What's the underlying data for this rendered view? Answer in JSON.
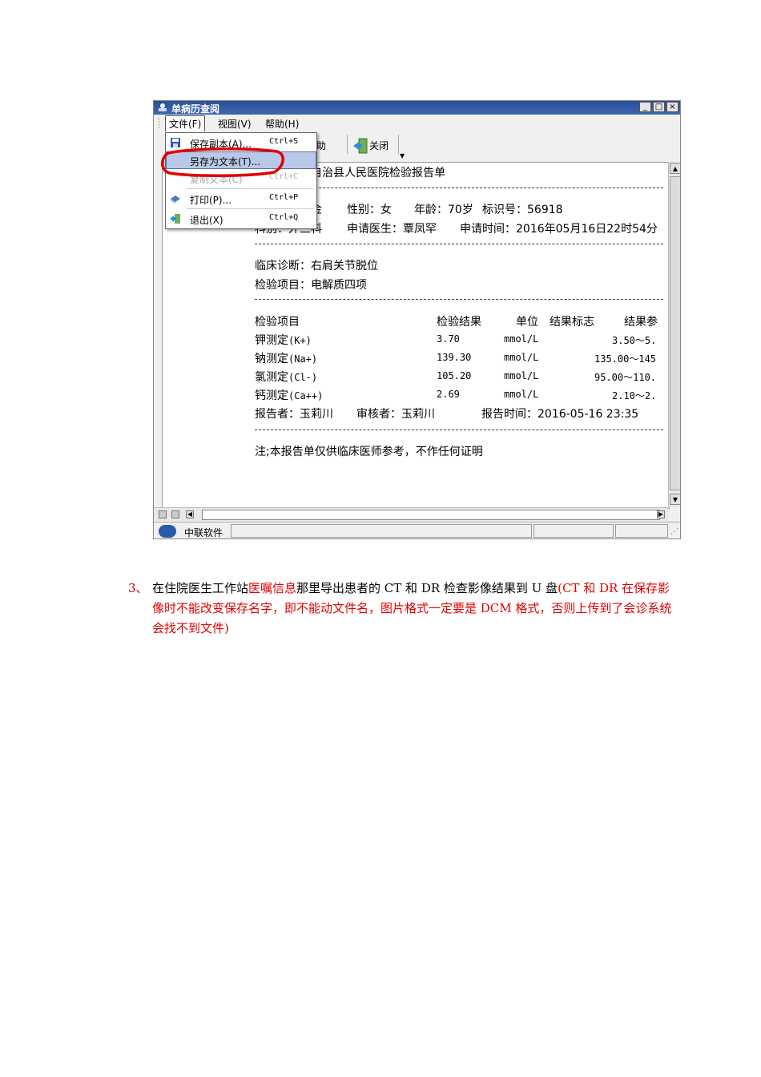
{
  "window": {
    "title": "单病历查阅",
    "controls": [
      "_",
      "□",
      "×"
    ]
  },
  "menubar": {
    "items": [
      "文件(F)",
      "视图(V)",
      "帮助(H)"
    ]
  },
  "toolbar": {
    "help_label": "帮助",
    "close_label": "关闭"
  },
  "file_menu": {
    "items": [
      {
        "label": "保存副本(A)...",
        "shortcut": "Ctrl+S"
      },
      {
        "label": "另存为文本(T)...",
        "shortcut": ""
      },
      {
        "label": "复制文本(C)",
        "shortcut": "Ctrl+C"
      },
      {
        "label": "打印(P)...",
        "shortcut": "Ctrl+P"
      },
      {
        "label": "退出(X)",
        "shortcut": "Ctrl+Q"
      }
    ]
  },
  "report": {
    "title_line": "自治县人民医院检验报告单",
    "name_tail": "金",
    "gender": "性别：女",
    "age": "年龄：70岁",
    "id_no": "标识号：56918",
    "dept": "科别：外三科",
    "doctor": "申请医生：覃凤罕",
    "request_time": "申请时间：2016年05月16日22时54分",
    "diagnosis": "临床诊断：右肩关节脱位",
    "test_item": "检验项目：电解质四项",
    "columns": [
      "检验项目",
      "检验结果",
      "单位",
      "结果标志",
      "结果参"
    ],
    "rows": [
      {
        "name": "钾测定",
        "code": "(K+)",
        "result": "3.70",
        "unit": "mmol/L",
        "ref": "3.50～5."
      },
      {
        "name": "钠测定",
        "code": "(Na+)",
        "result": "139.30",
        "unit": "mmol/L",
        "ref": "135.00～145"
      },
      {
        "name": "氯测定",
        "code": "(Cl-)",
        "result": "105.20",
        "unit": "mmol/L",
        "ref": "95.00～110."
      },
      {
        "name": "钙测定",
        "code": "(Ca++)",
        "result": "2.69",
        "unit": "mmol/L",
        "ref": "2.10～2."
      }
    ],
    "reporter": "报告者：玉莉川",
    "reviewer": "审核者：玉莉川",
    "report_time": "报告时间：2016-05-16 23:35",
    "note": "注;本报告单仅供临床医师参考，不作任何证明"
  },
  "statusbar": {
    "company": "中联软件"
  },
  "caption": {
    "number": "3、",
    "part1": "在住院医生工作站",
    "part2_red": "医嘱信息",
    "part3": "那里导出患者的 CT 和 DR 检查影像结果到 U 盘",
    "part4_red": "(CT 和 DR 在保存影像时不能改变保存名字，即不能动文件名，图片格式一定要是 DCM 格式，否则上传到了会诊系统会找不到文件)"
  },
  "colors": {
    "titlebar": "#2a4f9a",
    "highlight": "#b8c8e8",
    "annotation": "#e00000",
    "caption_red": "#e00000"
  }
}
